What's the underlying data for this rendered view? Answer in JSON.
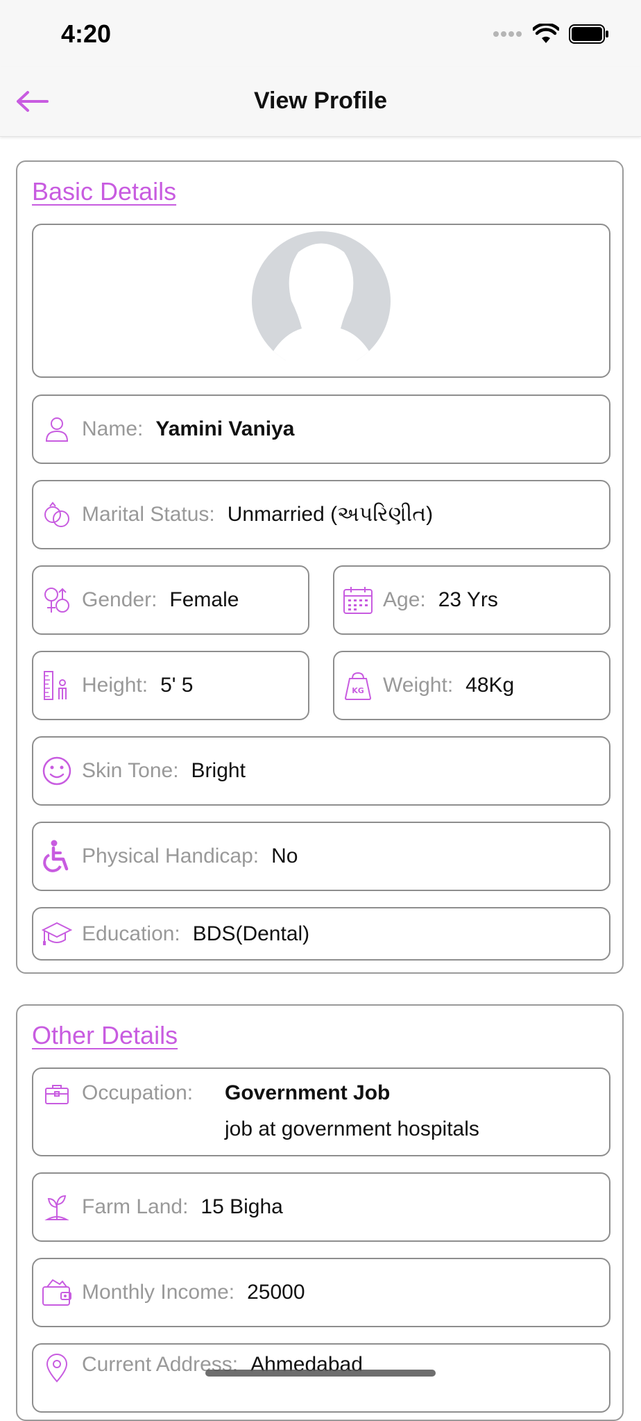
{
  "status_bar": {
    "time": "4:20"
  },
  "header": {
    "title": "View Profile"
  },
  "basic_details": {
    "title": "Basic Details",
    "fields": [
      {
        "key": "name",
        "label": "Name:",
        "value": "Yamini Vaniya",
        "icon": "person-icon"
      },
      {
        "key": "marital",
        "label": "Marital Status:",
        "value": "Unmarried (અપરિણીત)",
        "icon": "rings-icon"
      },
      {
        "key": "gender",
        "label": "Gender:",
        "value": "Female",
        "icon": "gender-icon"
      },
      {
        "key": "age",
        "label": "Age:",
        "value": "23 Yrs",
        "icon": "calendar-icon"
      },
      {
        "key": "height",
        "label": "Height:",
        "value": "5' 5",
        "icon": "height-ruler-icon"
      },
      {
        "key": "weight",
        "label": "Weight:",
        "value": "48Kg",
        "icon": "weight-kg-icon"
      },
      {
        "key": "skin",
        "label": "Skin Tone:",
        "value": "Bright",
        "icon": "smiley-icon"
      },
      {
        "key": "handicap",
        "label": "Physical Handicap:",
        "value": "No",
        "icon": "wheelchair-icon"
      },
      {
        "key": "education",
        "label": "Education:",
        "value": "BDS(Dental)",
        "icon": "graduation-cap-icon"
      }
    ]
  },
  "other_details": {
    "title": "Other Details",
    "occupation": {
      "label": "Occupation:",
      "value": "Government Job",
      "description": "job at government hospitals",
      "icon": "briefcase-icon"
    },
    "fields": [
      {
        "key": "farm",
        "label": "Farm Land:",
        "value": "15 Bigha",
        "icon": "sprout-icon"
      },
      {
        "key": "income",
        "label": "Monthly Income:",
        "value": "25000",
        "icon": "wallet-icon"
      },
      {
        "key": "address",
        "label": "Current Address:",
        "value": "Ahmedabad",
        "icon": "location-pin-icon"
      }
    ]
  },
  "colors": {
    "accent": "#c85ce0",
    "border": "#8e8e8e",
    "label": "#999999"
  }
}
